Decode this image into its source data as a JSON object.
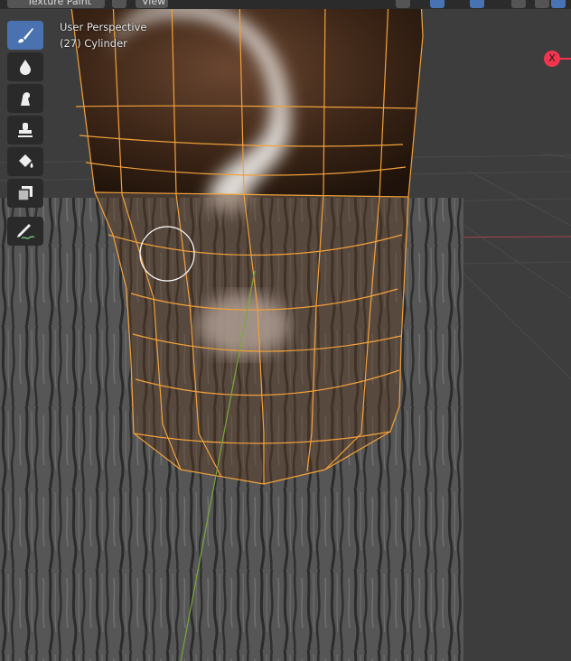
{
  "header": {
    "mode_label": "Texture Paint",
    "view_label": "View"
  },
  "viewport": {
    "perspective_label": "User Perspective",
    "object_label": "(27) Cylinder",
    "axis_gizmo_label": "X"
  },
  "toolbar": {
    "tools": [
      {
        "name": "draw-tool",
        "icon": "brush-icon",
        "active": true
      },
      {
        "name": "soften-tool",
        "icon": "drop-icon",
        "active": false
      },
      {
        "name": "smear-tool",
        "icon": "smear-icon",
        "active": false
      },
      {
        "name": "clone-tool",
        "icon": "stamp-icon",
        "active": false
      },
      {
        "name": "fill-tool",
        "icon": "bucket-icon",
        "active": false
      },
      {
        "name": "mask-tool",
        "icon": "mask-icon",
        "active": false
      },
      {
        "name": "annotate-tool",
        "icon": "annotate-icon",
        "active": false
      }
    ]
  },
  "colors": {
    "accent": "#4a72b0",
    "wireframe": "#f2a13a",
    "axis_x": "#f0354f",
    "axis_y": "#7aa83a",
    "background": "#3d3d3d"
  }
}
